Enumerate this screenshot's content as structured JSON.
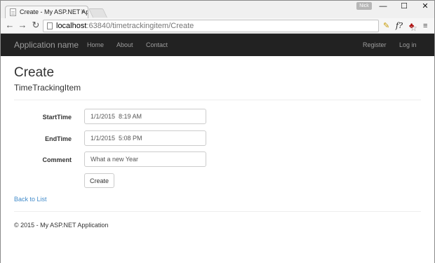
{
  "browser": {
    "tab_title": "Create - My ASP.NET App",
    "tab_close": "×",
    "user_badge": "Nick",
    "win_min": "—",
    "win_max": "☐",
    "win_close": "✕",
    "back_icon": "←",
    "forward_icon": "→",
    "reload_icon": "↻",
    "url_host": "localhost",
    "url_path": ":63840/timetrackingitem/Create",
    "star_icon": "☆",
    "ext1_icon": "✎",
    "ext2_icon": "f?",
    "ext3_icon": "♣",
    "menu_icon": "≡"
  },
  "nav": {
    "brand": "Application name",
    "links": [
      "Home",
      "About",
      "Contact"
    ],
    "right_links": [
      "Register",
      "Log in"
    ]
  },
  "page": {
    "title": "Create",
    "subtitle": "TimeTrackingItem",
    "fields": [
      {
        "label": "StartTime",
        "value": "1/1/2015  8:19 AM",
        "placeholder": ""
      },
      {
        "label": "EndTime",
        "value": "1/1/2015  5:08 PM",
        "placeholder": ""
      },
      {
        "label": "Comment",
        "value": "What a new Year",
        "placeholder": ""
      }
    ],
    "submit_label": "Create",
    "back_link": "Back to List",
    "footer": "© 2015 - My ASP.NET Application"
  },
  "colors": {
    "navbar": "#222222",
    "nav_text": "#9d9d9d",
    "link": "#428bca"
  }
}
